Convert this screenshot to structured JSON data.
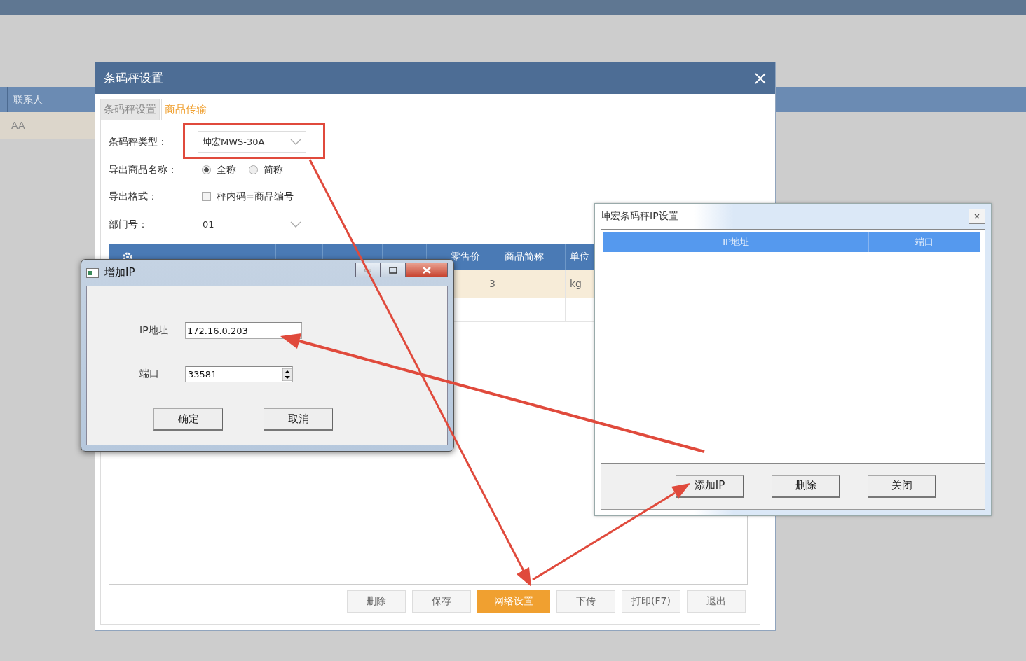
{
  "background_app": {
    "columns": [
      "联系人"
    ],
    "rows": [
      [
        "AA"
      ]
    ]
  },
  "main_dialog": {
    "title": "条码秤设置",
    "tabs": [
      {
        "label": "条码秤设置",
        "selected": false
      },
      {
        "label": "商品传输",
        "selected": true
      }
    ],
    "scale_type": {
      "label": "条码秤类型：",
      "value": "坤宏MWS-30A",
      "highlighted": true
    },
    "export_name": {
      "label": "导出商品名称：",
      "options": [
        {
          "label": "全称",
          "selected": true
        },
        {
          "label": "简称",
          "selected": false
        }
      ]
    },
    "export_format": {
      "label": "导出格式：",
      "option": {
        "label": "秤内码=商品编号",
        "checked": false
      }
    },
    "department": {
      "label": "部门号：",
      "value": "01"
    },
    "table": {
      "columns": [
        "零售价",
        "商品简称",
        "单位"
      ],
      "rows": [
        {
          "retail_price": "3",
          "unit": "kg"
        }
      ]
    },
    "buttons": [
      {
        "label": "删除",
        "primary": false
      },
      {
        "label": "保存",
        "primary": false
      },
      {
        "label": "网络设置",
        "primary": true
      },
      {
        "label": "下传",
        "primary": false
      },
      {
        "label": "打印(F7)",
        "primary": false
      },
      {
        "label": "退出",
        "primary": false
      }
    ]
  },
  "add_ip_dialog": {
    "title": "增加IP",
    "ip": {
      "label": "IP地址",
      "value": "172.16.0.203"
    },
    "port": {
      "label": "端口",
      "value": "33581"
    },
    "buttons": [
      "确定",
      "取消"
    ]
  },
  "ip_settings_dialog": {
    "title": "坤宏条码秤IP设置",
    "columns": [
      "IP地址",
      "端口"
    ],
    "buttons": [
      "添加IP",
      "删除",
      "关闭"
    ]
  }
}
